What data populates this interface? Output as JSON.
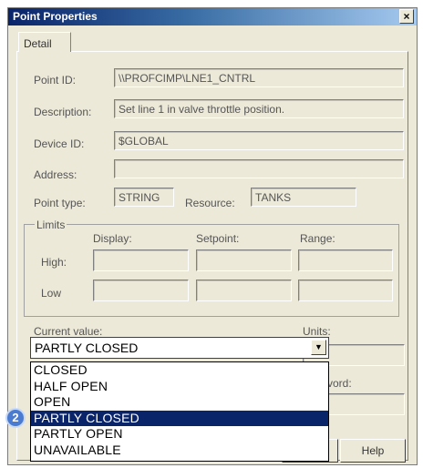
{
  "window": {
    "title": "Point Properties",
    "close_glyph": "×"
  },
  "tabs": [
    {
      "label": "Detail"
    }
  ],
  "fields": {
    "point_id": {
      "label": "Point ID:",
      "value": "\\\\PROFCIMP\\LNE1_CNTRL"
    },
    "description": {
      "label": "Description:",
      "value": "Set line 1 in valve  throttle position."
    },
    "device_id": {
      "label": "Device ID:",
      "value": "$GLOBAL"
    },
    "address": {
      "label": "Address:",
      "value": ""
    },
    "point_type": {
      "label": "Point type:",
      "value": "STRING"
    },
    "resource": {
      "label": "Resource:",
      "value": "TANKS"
    }
  },
  "limits": {
    "legend": "Limits",
    "columns": [
      "Display:",
      "Setpoint:",
      "Range:"
    ],
    "rows": [
      "High:",
      "Low"
    ]
  },
  "current_value": {
    "label": "Current value:",
    "selected": "PARTLY CLOSED",
    "options": [
      "CLOSED",
      "HALF OPEN",
      "OPEN",
      "PARTLY CLOSED",
      "PARTLY OPEN",
      "UNAVAILABLE"
    ],
    "highlighted_index": 3
  },
  "units": {
    "label": "Units:",
    "value": ""
  },
  "password_partial": {
    "label": "vord:"
  },
  "callout_badge": "2",
  "buttons": {
    "help": "Help"
  }
}
